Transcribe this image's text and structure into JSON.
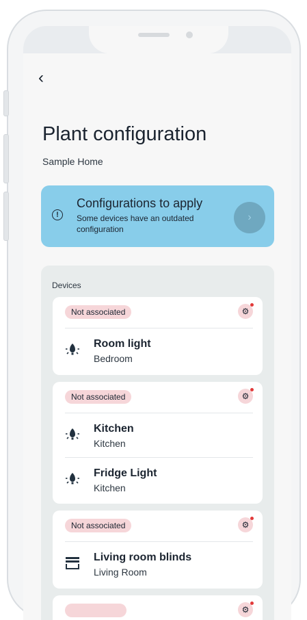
{
  "page": {
    "title": "Plant configuration",
    "subtitle": "Sample Home"
  },
  "banner": {
    "title": "Configurations to apply",
    "description": "Some devices have an outdated configuration"
  },
  "devices_label": "Devices",
  "cards": [
    {
      "status": "Not associated",
      "devices": [
        {
          "name": "Room light",
          "room": "Bedroom",
          "icon": "bulb-icon"
        }
      ]
    },
    {
      "status": "Not associated",
      "devices": [
        {
          "name": "Kitchen",
          "room": "Kitchen",
          "icon": "bulb-icon"
        },
        {
          "name": "Fridge Light",
          "room": "Kitchen",
          "icon": "bulb-icon"
        }
      ]
    },
    {
      "status": "Not associated",
      "devices": [
        {
          "name": "Living room blinds",
          "room": "Living Room",
          "icon": "blinds-icon"
        }
      ]
    }
  ],
  "colors": {
    "banner": "#88cdea",
    "chip": "#f6d6d9",
    "alert_dot": "#e23a3a",
    "panel": "#e8ecec"
  }
}
